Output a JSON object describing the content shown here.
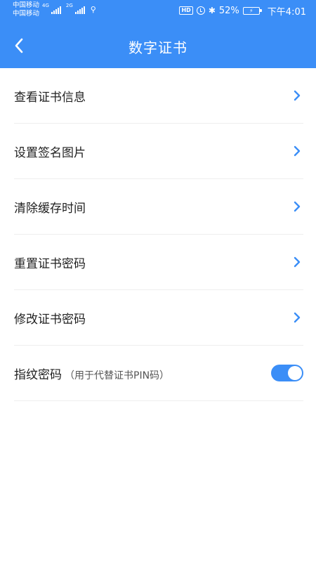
{
  "status": {
    "carrier1": "中国移动",
    "carrier2": "中国移动",
    "net1": "4G",
    "net2": "2G",
    "battery": "52%",
    "time": "下午4:01",
    "hd": "HD"
  },
  "header": {
    "title": "数字证书",
    "back_icon": "chevron-left-icon",
    "color": "#3B8EF7"
  },
  "menu": {
    "items": [
      {
        "label": "查看证书信息"
      },
      {
        "label": "设置签名图片"
      },
      {
        "label": "清除缓存时间"
      },
      {
        "label": "重置证书密码"
      },
      {
        "label": "修改证书密码"
      }
    ]
  },
  "fingerprint": {
    "label": "指纹密码",
    "note": "（用于代替证书PIN码）",
    "enabled": true
  }
}
